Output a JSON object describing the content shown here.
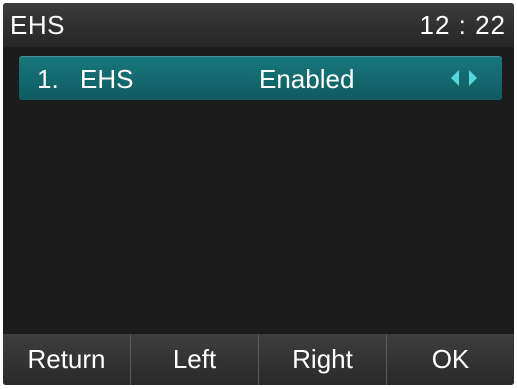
{
  "status_bar": {
    "title": "EHS",
    "time": "12 : 22"
  },
  "list": {
    "items": [
      {
        "index": "1.",
        "label": "EHS",
        "value": "Enabled",
        "selected": true
      }
    ]
  },
  "softkeys": [
    {
      "label": "Return"
    },
    {
      "label": "Left"
    },
    {
      "label": "Right"
    },
    {
      "label": "OK"
    }
  ],
  "colors": {
    "selection": "#17787e",
    "arrow": "#58d6dd",
    "background": "#1c1c1c"
  },
  "icons": {
    "value_selector": "left-right-arrows-icon"
  }
}
